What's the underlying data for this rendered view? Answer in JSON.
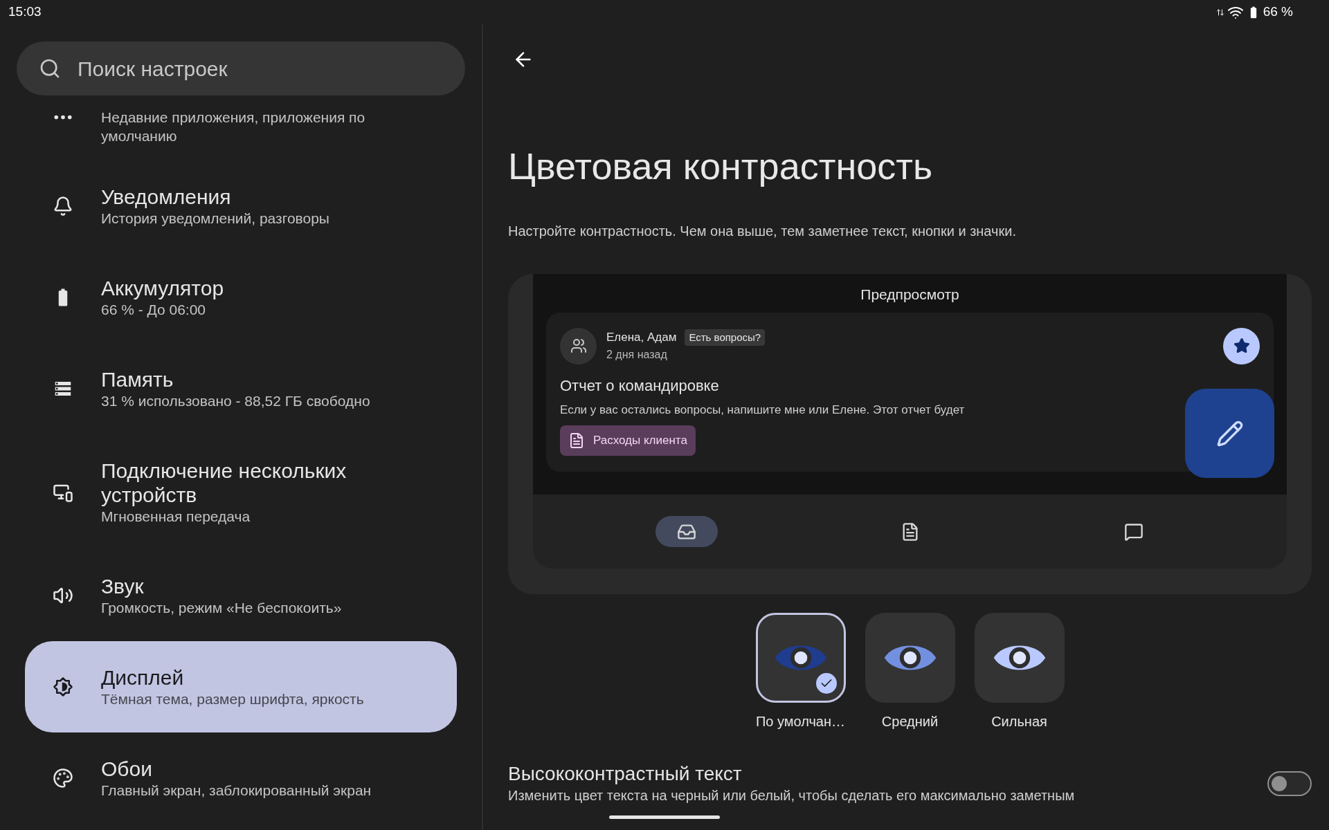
{
  "status_bar": {
    "time": "15:03",
    "battery": "66 %"
  },
  "sidebar": {
    "search": {
      "placeholder": "Поиск настроек"
    },
    "items": [
      {
        "subtitle": "Недавние приложения, приложения по умолчанию",
        "selected": false
      },
      {
        "title": "Уведомления",
        "subtitle": "История уведомлений, разговоры",
        "selected": false
      },
      {
        "title": "Аккумулятор",
        "subtitle": "66 % - До 06:00",
        "selected": false
      },
      {
        "title": "Память",
        "subtitle": "31 % использовано - 88,52 ГБ свободно",
        "selected": false
      },
      {
        "title": "Подключение нескольких устройств",
        "subtitle": "Мгновенная передача",
        "selected": false
      },
      {
        "title": "Звук",
        "subtitle": "Громкость, режим «Не беспокоить»",
        "selected": false
      },
      {
        "title": "Дисплей",
        "subtitle": "Тёмная тема, размер шрифта, яркость",
        "selected": true
      },
      {
        "title": "Обои",
        "subtitle": "Главный экран, заблокированный экран",
        "selected": false
      }
    ]
  },
  "page": {
    "title": "Цветовая контрастность",
    "description": "Настройте контрастность. Чем она выше, тем заметнее текст, кнопки и значки.",
    "preview": {
      "title": "Предпросмотр",
      "sender": "Елена, Адам",
      "tag": "Есть вопросы?",
      "time": "2 дня назад",
      "subject": "Отчет о командировке",
      "body": "Если у вас остались вопросы, напишите мне или Елене. Этот отчет будет",
      "attachment": "Расходы клиента",
      "nav": [
        {
          "selected": true
        },
        {
          "selected": false
        },
        {
          "selected": false
        }
      ]
    },
    "contrast_options": [
      {
        "label": "По умолчан…",
        "selected": true,
        "color": "#1f3c8f"
      },
      {
        "label": "Средний",
        "selected": false,
        "color": "#7390e0"
      },
      {
        "label": "Сильная",
        "selected": false,
        "color": "#b9c9ff"
      }
    ],
    "high_contrast_text": {
      "title": "Высококонтрастный текст",
      "description": "Изменить цвет текста на черный или белый, чтобы сделать его максимально заметным",
      "on": false
    }
  }
}
